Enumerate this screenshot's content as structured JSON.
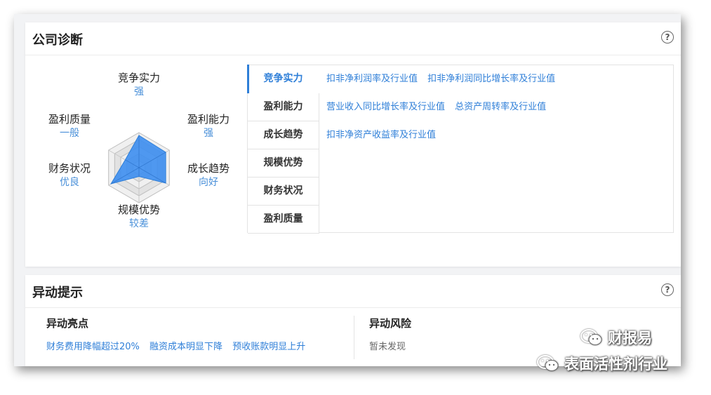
{
  "diagnosis": {
    "title": "公司诊断",
    "help": "?",
    "radar": {
      "competition": {
        "name": "竞争实力",
        "value": "强",
        "score": 0.92
      },
      "profitability": {
        "name": "盈利能力",
        "value": "强",
        "score": 0.88
      },
      "growth": {
        "name": "成长趋势",
        "value": "向好",
        "score": 0.88
      },
      "scale": {
        "name": "规模优势",
        "value": "较差",
        "score": 0.25
      },
      "financial": {
        "name": "财务状况",
        "value": "优良",
        "score": 0.92
      },
      "quality": {
        "name": "盈利质量",
        "value": "一般",
        "score": 0.45
      }
    },
    "tabs": [
      "竞争实力",
      "盈利能力",
      "成长趋势",
      "规模优势",
      "财务状况",
      "盈利质量"
    ],
    "links": [
      [
        "扣非净利润率及行业值",
        "扣非净利润同比增长率及行业值"
      ],
      [
        "营业收入同比增长率及行业值",
        "总资产周转率及行业值"
      ],
      [
        "扣非净资产收益率及行业值"
      ]
    ]
  },
  "alerts": {
    "title": "异动提示",
    "help": "?",
    "highlights_title": "异动亮点",
    "highlights": [
      "财务费用降幅超过20%",
      "融资成本明显下降",
      "预收账款明显上升"
    ],
    "risks_title": "异动风险",
    "risks_none": "暂未发现"
  },
  "watermark": {
    "line1": "财报易",
    "line2": "表面活性剂行业"
  },
  "colors": {
    "accent": "#2f7fd8",
    "radar_fill": "#3d8ef0",
    "value_text": "#4a90d9"
  }
}
